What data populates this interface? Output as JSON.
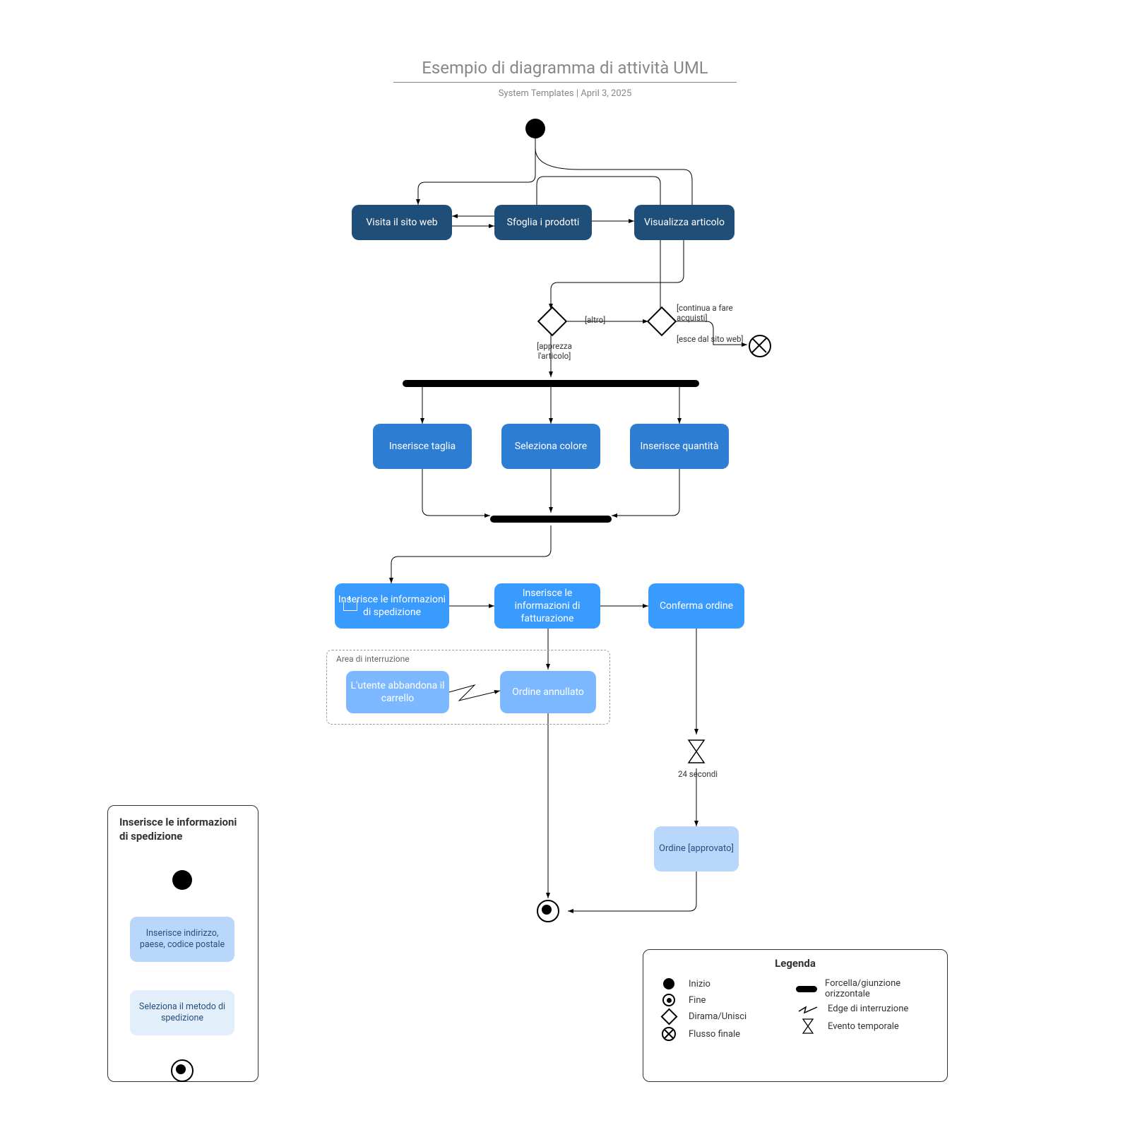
{
  "header": {
    "title": "Esempio di diagramma di attività UML",
    "subtitle": "System Templates  |  April 3, 2025"
  },
  "activities": {
    "visit": "Visita il sito web",
    "browse": "Sfoglia i prodotti",
    "view": "Visualizza articolo",
    "size": "Inserisce taglia",
    "color": "Seleziona colore",
    "qty": "Inserisce quantità",
    "ship": "Inserisce le informazioni di spedizione",
    "bill": "Inserisce le informazioni di fatturazione",
    "confirm": "Conferma ordine",
    "abandon": "L'utente abbandona il carrello",
    "cancelled": "Ordine annullato",
    "approved": "Ordine [approvato]"
  },
  "guards": {
    "other": "[altro]",
    "likes": "[apprezza l'articolo]",
    "keep_shopping": "[continua a fare acquisti]",
    "leave": "[esce dal sito web]"
  },
  "region": {
    "label": "Area di interruzione"
  },
  "timer": {
    "label": "24 secondi"
  },
  "subpanel": {
    "title": "Inserisce le informazioni di spedizione",
    "step1": "Inserisce indirizzo, paese, codice postale",
    "step2": "Seleziona il metodo di spedizione"
  },
  "legend": {
    "title": "Legenda",
    "start": "Inizio",
    "end": "Fine",
    "branch": "Dirama/Unisci",
    "flow_final": "Flusso finale",
    "fork": "Forcella/giunzione orizzontale",
    "interrupt": "Edge di interruzione",
    "time": "Evento temporale"
  }
}
